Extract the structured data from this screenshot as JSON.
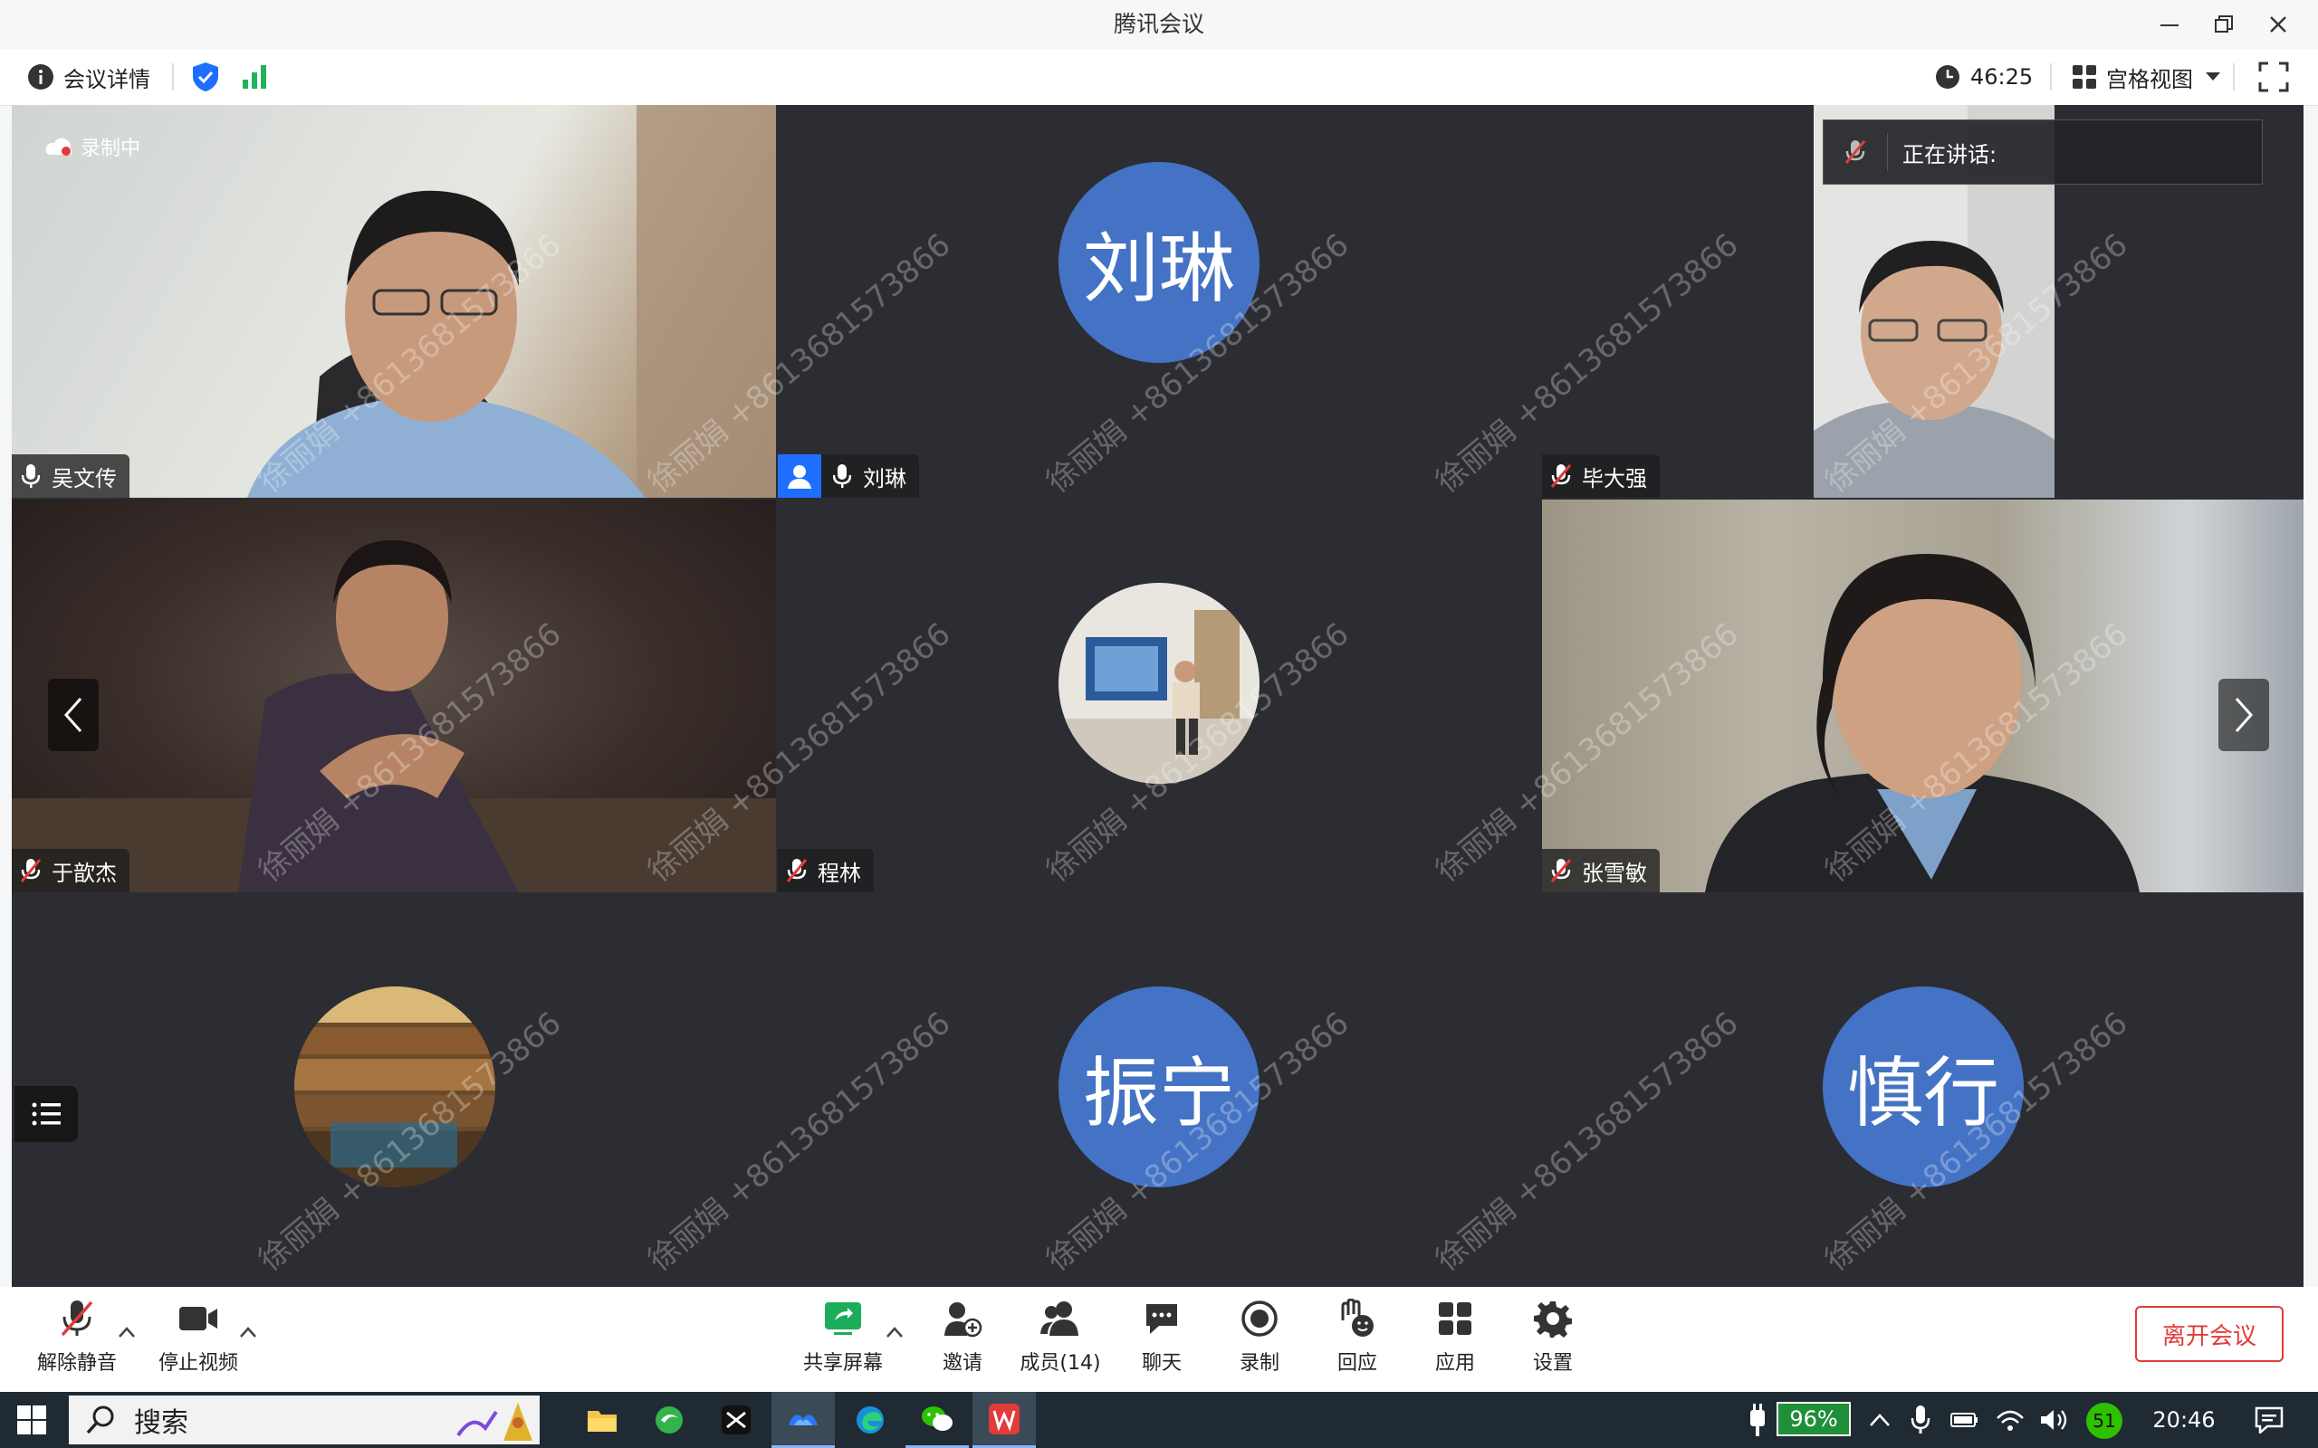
{
  "window": {
    "title": "腾讯会议"
  },
  "infobar": {
    "details_label": "会议详情",
    "timer": "46:25",
    "view_label": "宫格视图"
  },
  "recording_badge": "录制中",
  "speaking": {
    "label": "正在讲话:"
  },
  "watermark": "徐丽娟 +8613681573866",
  "participants": [
    {
      "name": "吴文传",
      "muted": false
    },
    {
      "name": "刘琳",
      "muted": false,
      "avatar_text": "刘琳",
      "host": true
    },
    {
      "name": "毕大强",
      "muted": true
    },
    {
      "name": "于歆杰",
      "muted": true
    },
    {
      "name": "程林",
      "muted": true
    },
    {
      "name": "张雪敏",
      "muted": true
    },
    {
      "name": "",
      "muted": false
    },
    {
      "name": "",
      "muted": false,
      "avatar_text": "振宁"
    },
    {
      "name": "",
      "muted": false,
      "avatar_text": "慎行"
    }
  ],
  "toolbar": {
    "unmute": "解除静音",
    "stop_video": "停止视频",
    "share_screen": "共享屏幕",
    "invite": "邀请",
    "members": "成员(14)",
    "chat": "聊天",
    "record": "录制",
    "react": "回应",
    "apps": "应用",
    "settings": "设置",
    "leave": "离开会议"
  },
  "taskbar": {
    "search": "搜索",
    "battery": "96%",
    "wechat_badge": "51",
    "clock": "20:46"
  },
  "colors": {
    "accent": "#1e6fff",
    "avatar_blue": "#4472c4",
    "leave_red": "#e23a3a",
    "signal_green": "#1fb35b"
  }
}
